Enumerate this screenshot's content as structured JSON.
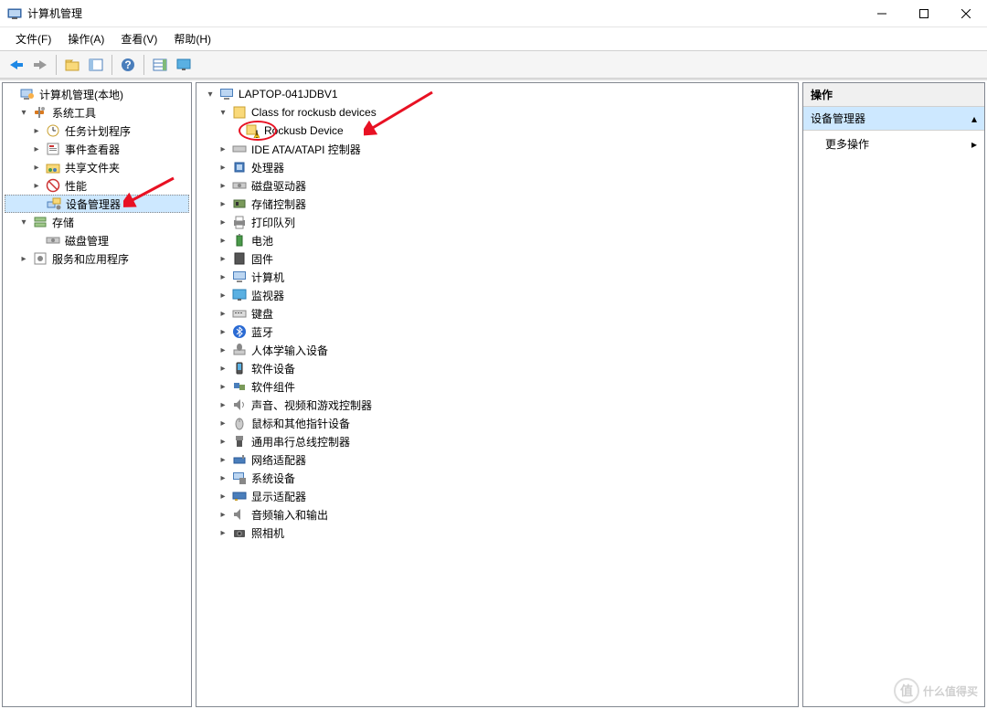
{
  "window": {
    "title": "计算机管理"
  },
  "menubar": {
    "file": "文件(F)",
    "action": "操作(A)",
    "view": "查看(V)",
    "help": "帮助(H)"
  },
  "left_tree": {
    "root": "计算机管理(本地)",
    "system_tools": "系统工具",
    "task_scheduler": "任务计划程序",
    "event_viewer": "事件查看器",
    "shared_folders": "共享文件夹",
    "performance": "性能",
    "device_manager": "设备管理器",
    "storage": "存储",
    "disk_management": "磁盘管理",
    "services_apps": "服务和应用程序"
  },
  "device_tree": {
    "computer": "LAPTOP-041JDBV1",
    "class_rockusb": "Class for rockusb devices",
    "rockusb_device": "Rockusb Device",
    "ide_atapi": "IDE ATA/ATAPI 控制器",
    "processor": "处理器",
    "disk_drives": "磁盘驱动器",
    "storage_controllers": "存储控制器",
    "print_queues": "打印队列",
    "batteries": "电池",
    "firmware": "固件",
    "computer_cat": "计算机",
    "monitors": "监视器",
    "keyboards": "键盘",
    "bluetooth": "蓝牙",
    "hid": "人体学输入设备",
    "software_devices": "软件设备",
    "software_components": "软件组件",
    "sound_video_game": "声音、视频和游戏控制器",
    "mice": "鼠标和其他指针设备",
    "usb_controllers": "通用串行总线控制器",
    "network_adapters": "网络适配器",
    "system_devices": "系统设备",
    "display_adapters": "显示适配器",
    "audio_io": "音频输入和输出",
    "cameras": "照相机"
  },
  "actions": {
    "header": "操作",
    "section": "设备管理器",
    "more": "更多操作"
  },
  "watermark": "什么值得买"
}
